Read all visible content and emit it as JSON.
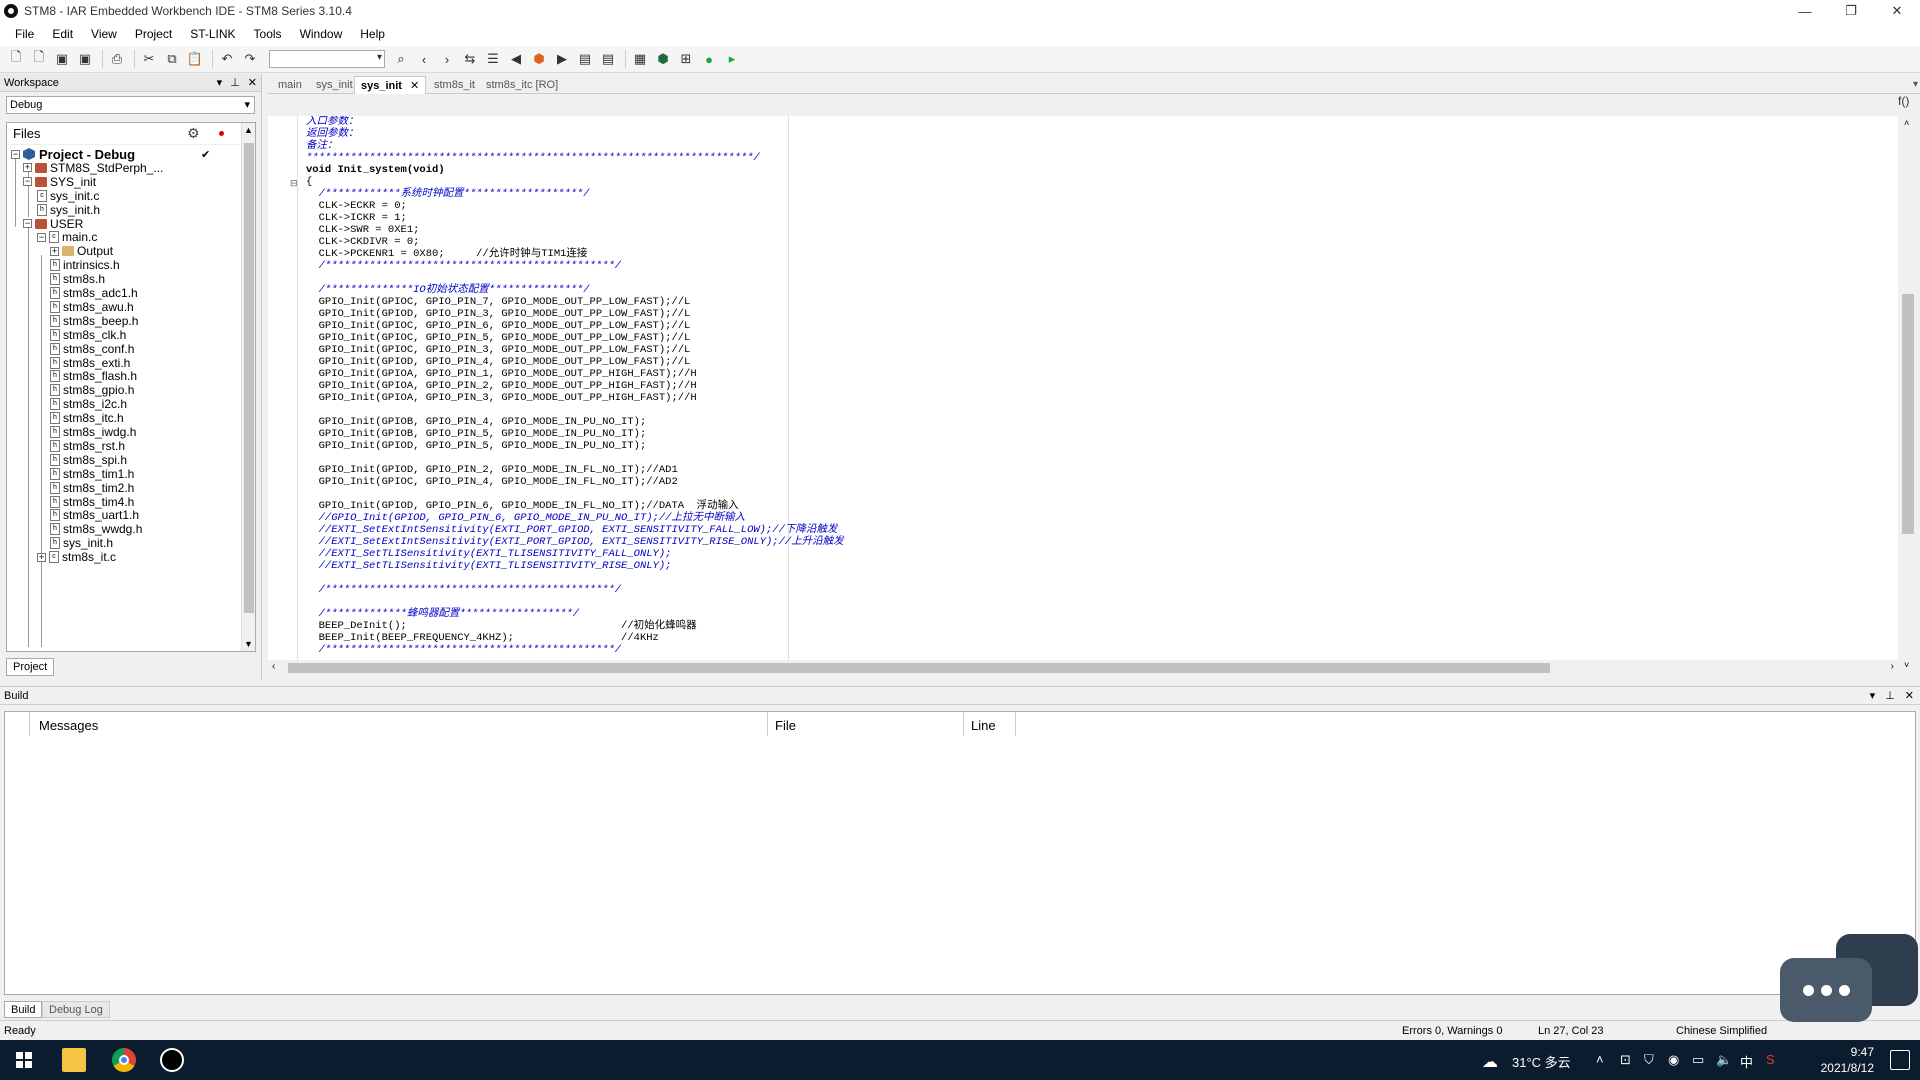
{
  "window": {
    "title": "STM8 - IAR Embedded Workbench IDE - STM8 Series 3.10.4",
    "minimize": "—",
    "restore": "❐",
    "close": "✕"
  },
  "menu": [
    "File",
    "Edit",
    "View",
    "Project",
    "ST-LINK",
    "Tools",
    "Window",
    "Help"
  ],
  "workspace": {
    "header": "Workspace",
    "config": "Debug",
    "files_label": "Files",
    "tab": "Project",
    "tree": [
      {
        "label": "Project - Debug",
        "level": 0,
        "kind": "project",
        "check": "✔"
      },
      {
        "label": "STM8S_StdPerph_...",
        "level": 1,
        "kind": "folder"
      },
      {
        "label": "SYS_init",
        "level": 1,
        "kind": "folder"
      },
      {
        "label": "sys_init.c",
        "level": 2,
        "kind": "file-c"
      },
      {
        "label": "sys_init.h",
        "level": 2,
        "kind": "file-h"
      },
      {
        "label": "USER",
        "level": 1,
        "kind": "folder"
      },
      {
        "label": "main.c",
        "level": 2,
        "kind": "file-c"
      },
      {
        "label": "Output",
        "level": 3,
        "kind": "folder"
      },
      {
        "label": "intrinsics.h",
        "level": 3,
        "kind": "file-h"
      },
      {
        "label": "stm8s.h",
        "level": 3,
        "kind": "file-h"
      },
      {
        "label": "stm8s_adc1.h",
        "level": 3,
        "kind": "file-h"
      },
      {
        "label": "stm8s_awu.h",
        "level": 3,
        "kind": "file-h"
      },
      {
        "label": "stm8s_beep.h",
        "level": 3,
        "kind": "file-h"
      },
      {
        "label": "stm8s_clk.h",
        "level": 3,
        "kind": "file-h"
      },
      {
        "label": "stm8s_conf.h",
        "level": 3,
        "kind": "file-h"
      },
      {
        "label": "stm8s_exti.h",
        "level": 3,
        "kind": "file-h"
      },
      {
        "label": "stm8s_flash.h",
        "level": 3,
        "kind": "file-h"
      },
      {
        "label": "stm8s_gpio.h",
        "level": 3,
        "kind": "file-h"
      },
      {
        "label": "stm8s_i2c.h",
        "level": 3,
        "kind": "file-h"
      },
      {
        "label": "stm8s_itc.h",
        "level": 3,
        "kind": "file-h"
      },
      {
        "label": "stm8s_iwdg.h",
        "level": 3,
        "kind": "file-h"
      },
      {
        "label": "stm8s_rst.h",
        "level": 3,
        "kind": "file-h"
      },
      {
        "label": "stm8s_spi.h",
        "level": 3,
        "kind": "file-h"
      },
      {
        "label": "stm8s_tim1.h",
        "level": 3,
        "kind": "file-h"
      },
      {
        "label": "stm8s_tim2.h",
        "level": 3,
        "kind": "file-h"
      },
      {
        "label": "stm8s_tim4.h",
        "level": 3,
        "kind": "file-h"
      },
      {
        "label": "stm8s_uart1.h",
        "level": 3,
        "kind": "file-h"
      },
      {
        "label": "stm8s_wwdg.h",
        "level": 3,
        "kind": "file-h"
      },
      {
        "label": "sys_init.h",
        "level": 3,
        "kind": "file-h"
      },
      {
        "label": "stm8s_it.c",
        "level": 2,
        "kind": "file-c"
      }
    ]
  },
  "editor": {
    "tabs": [
      {
        "label": "main",
        "active": false
      },
      {
        "label": "sys_init",
        "active": false
      },
      {
        "label": "sys_init",
        "active": true,
        "close": "✕"
      },
      {
        "label": "stm8s_it",
        "active": false
      },
      {
        "label": "stm8s_itc [RO]",
        "active": false
      }
    ],
    "fold_marker": "⊟",
    "func_icon": "f()",
    "lines": [
      {
        "c": "入口参数：",
        "t": "comment"
      },
      {
        "c": "返回参数：",
        "t": "comment"
      },
      {
        "c": "备注：",
        "t": "comment"
      },
      {
        "c": "***********************************************************************/",
        "t": "comment"
      },
      {
        "c": "void Init_system(void)",
        "t": "kw"
      },
      {
        "c": "{",
        "t": "code"
      },
      {
        "c": "  /************系统时钟配置*******************/",
        "t": "comment"
      },
      {
        "c": "  CLK->ECKR = 0;",
        "t": "code"
      },
      {
        "c": "  CLK->ICKR = 1;",
        "t": "code"
      },
      {
        "c": "  CLK->SWR = 0XE1;",
        "t": "code"
      },
      {
        "c": "  CLK->CKDIVR = 0;",
        "t": "code"
      },
      {
        "c": "  CLK->PCKENR1 = 0X80;     //允许时钟与TIM1连接",
        "t": "code"
      },
      {
        "c": "  /**********************************************/",
        "t": "comment"
      },
      {
        "c": "",
        "t": "code"
      },
      {
        "c": "  /**************IO初始状态配置***************/",
        "t": "comment"
      },
      {
        "c": "  GPIO_Init(GPIOC, GPIO_PIN_7, GPIO_MODE_OUT_PP_LOW_FAST);//L",
        "t": "code"
      },
      {
        "c": "  GPIO_Init(GPIOD, GPIO_PIN_3, GPIO_MODE_OUT_PP_LOW_FAST);//L",
        "t": "code"
      },
      {
        "c": "  GPIO_Init(GPIOC, GPIO_PIN_6, GPIO_MODE_OUT_PP_LOW_FAST);//L",
        "t": "code"
      },
      {
        "c": "  GPIO_Init(GPIOC, GPIO_PIN_5, GPIO_MODE_OUT_PP_LOW_FAST);//L",
        "t": "code"
      },
      {
        "c": "  GPIO_Init(GPIOC, GPIO_PIN_3, GPIO_MODE_OUT_PP_LOW_FAST);//L",
        "t": "code"
      },
      {
        "c": "  GPIO_Init(GPIOD, GPIO_PIN_4, GPIO_MODE_OUT_PP_LOW_FAST);//L",
        "t": "code"
      },
      {
        "c": "  GPIO_Init(GPIOA, GPIO_PIN_1, GPIO_MODE_OUT_PP_HIGH_FAST);//H",
        "t": "code"
      },
      {
        "c": "  GPIO_Init(GPIOA, GPIO_PIN_2, GPIO_MODE_OUT_PP_HIGH_FAST);//H",
        "t": "code"
      },
      {
        "c": "  GPIO_Init(GPIOA, GPIO_PIN_3, GPIO_MODE_OUT_PP_HIGH_FAST);//H",
        "t": "code"
      },
      {
        "c": "",
        "t": "code"
      },
      {
        "c": "  GPIO_Init(GPIOB, GPIO_PIN_4, GPIO_MODE_IN_PU_NO_IT);",
        "t": "code"
      },
      {
        "c": "  GPIO_Init(GPIOB, GPIO_PIN_5, GPIO_MODE_IN_PU_NO_IT);",
        "t": "code"
      },
      {
        "c": "  GPIO_Init(GPIOD, GPIO_PIN_5, GPIO_MODE_IN_PU_NO_IT);",
        "t": "code"
      },
      {
        "c": "",
        "t": "code"
      },
      {
        "c": "  GPIO_Init(GPIOD, GPIO_PIN_2, GPIO_MODE_IN_FL_NO_IT);//AD1",
        "t": "code"
      },
      {
        "c": "  GPIO_Init(GPIOC, GPIO_PIN_4, GPIO_MODE_IN_FL_NO_IT);//AD2",
        "t": "code"
      },
      {
        "c": "",
        "t": "code"
      },
      {
        "c": "  GPIO_Init(GPIOD, GPIO_PIN_6, GPIO_MODE_IN_FL_NO_IT);//DATA  浮动输入",
        "t": "code"
      },
      {
        "c": "  //GPIO_Init(GPIOD, GPIO_PIN_6, GPIO_MODE_IN_PU_NO_IT);//上拉无中断输入",
        "t": "comment"
      },
      {
        "c": "  //EXTI_SetExtIntSensitivity(EXTI_PORT_GPIOD, EXTI_SENSITIVITY_FALL_LOW);//下降沿触发",
        "t": "comment"
      },
      {
        "c": "  //EXTI_SetExtIntSensitivity(EXTI_PORT_GPIOD, EXTI_SENSITIVITY_RISE_ONLY);//上升沿触发",
        "t": "comment"
      },
      {
        "c": "  //EXTI_SetTLISensitivity(EXTI_TLISENSITIVITY_FALL_ONLY);",
        "t": "comment"
      },
      {
        "c": "  //EXTI_SetTLISensitivity(EXTI_TLISENSITIVITY_RISE_ONLY);",
        "t": "comment"
      },
      {
        "c": "",
        "t": "code"
      },
      {
        "c": "  /**********************************************/",
        "t": "comment"
      },
      {
        "c": "",
        "t": "code"
      },
      {
        "c": "  /*************蜂鸣器配置******************/",
        "t": "comment"
      },
      {
        "c": "  BEEP_DeInit();                                  //初始化蜂鸣器",
        "t": "code"
      },
      {
        "c": "  BEEP_Init(BEEP_FREQUENCY_4KHZ);                 //4KHz",
        "t": "code"
      },
      {
        "c": "  /**********************************************/",
        "t": "comment"
      }
    ]
  },
  "build": {
    "header": "Build",
    "columns": [
      "Messages",
      "File",
      "Line"
    ],
    "tabs": [
      "Build",
      "Debug Log"
    ]
  },
  "status": {
    "ready": "Ready",
    "errors": "Errors 0, Warnings 0",
    "position": "Ln 27, Col 23",
    "language": "Chinese Simplified"
  },
  "taskbar": {
    "weather": "31°C 多云",
    "ime": "中",
    "time": "9:47",
    "date": "2021/8/12"
  }
}
